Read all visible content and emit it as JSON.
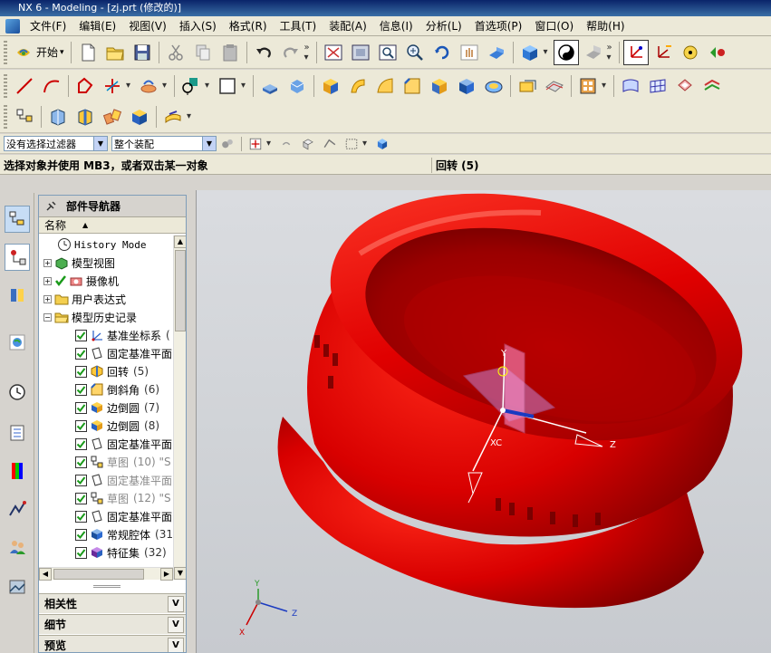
{
  "window": {
    "title": "NX 6 - Modeling - [zj.prt (修改的)]"
  },
  "menu": [
    "文件(F)",
    "编辑(E)",
    "视图(V)",
    "插入(S)",
    "格式(R)",
    "工具(T)",
    "装配(A)",
    "信息(I)",
    "分析(L)",
    "首选项(P)",
    "窗口(O)",
    "帮助(H)"
  ],
  "toolbar": {
    "start_label": "开始"
  },
  "filters": {
    "type_filter": "没有选择过滤器",
    "scope_filter": "整个装配"
  },
  "status": {
    "prompt": "选择对象并使用 MB3，或者双击某一对象",
    "cue": "回转 (5)"
  },
  "navigator": {
    "title": "部件导航器",
    "column_name": "名称",
    "tree": [
      {
        "label": "History Mode",
        "icon": "clock-icon",
        "level": 0
      },
      {
        "label": "模型视图",
        "icon": "model-view-icon",
        "level": 0
      },
      {
        "label": "摄像机",
        "icon": "camera-icon",
        "level": 0
      },
      {
        "label": "用户表达式",
        "icon": "folder-icon",
        "level": 0
      },
      {
        "label": "模型历史记录",
        "icon": "folder-icon",
        "level": 0
      },
      {
        "label": "基准坐标系",
        "count": "(",
        "icon": "datum-csys-icon",
        "level": 1
      },
      {
        "label": "固定基准平面",
        "count": "",
        "icon": "datum-plane-icon",
        "level": 1
      },
      {
        "label": "回转",
        "count": "(5)",
        "icon": "revolve-icon",
        "level": 1
      },
      {
        "label": "倒斜角",
        "count": "(6)",
        "icon": "chamfer-icon",
        "level": 1
      },
      {
        "label": "边倒圆",
        "count": "(7)",
        "icon": "edge-blend-icon",
        "level": 1
      },
      {
        "label": "边倒圆",
        "count": "(8)",
        "icon": "edge-blend-icon",
        "level": 1
      },
      {
        "label": "固定基准平面",
        "count": "",
        "icon": "datum-plane-icon",
        "level": 1
      },
      {
        "label": "草图",
        "count": "(10) \"S",
        "icon": "sketch-icon",
        "level": 1
      },
      {
        "label": "固定基准平面",
        "count": "",
        "icon": "datum-plane-icon",
        "level": 1
      },
      {
        "label": "草图",
        "count": "(12) \"S",
        "icon": "sketch-icon",
        "level": 1
      },
      {
        "label": "固定基准平面",
        "count": "",
        "icon": "datum-plane-icon",
        "level": 1
      },
      {
        "label": "常规腔体",
        "count": "(31",
        "icon": "pocket-icon",
        "level": 1
      },
      {
        "label": "特征集",
        "count": "(32)",
        "icon": "feature-set-icon",
        "level": 1
      }
    ],
    "panels": [
      "相关性",
      "细节",
      "预览"
    ]
  },
  "viewport": {
    "wcs_axes": {
      "x": "XC",
      "y": "Y",
      "z": "Z"
    },
    "triad_axes": {
      "x": "X",
      "y": "Y",
      "z": "Z"
    }
  },
  "colors": {
    "part_red": "#e00000",
    "part_dark": "#7a0000",
    "title_blue": "#0a246a"
  }
}
